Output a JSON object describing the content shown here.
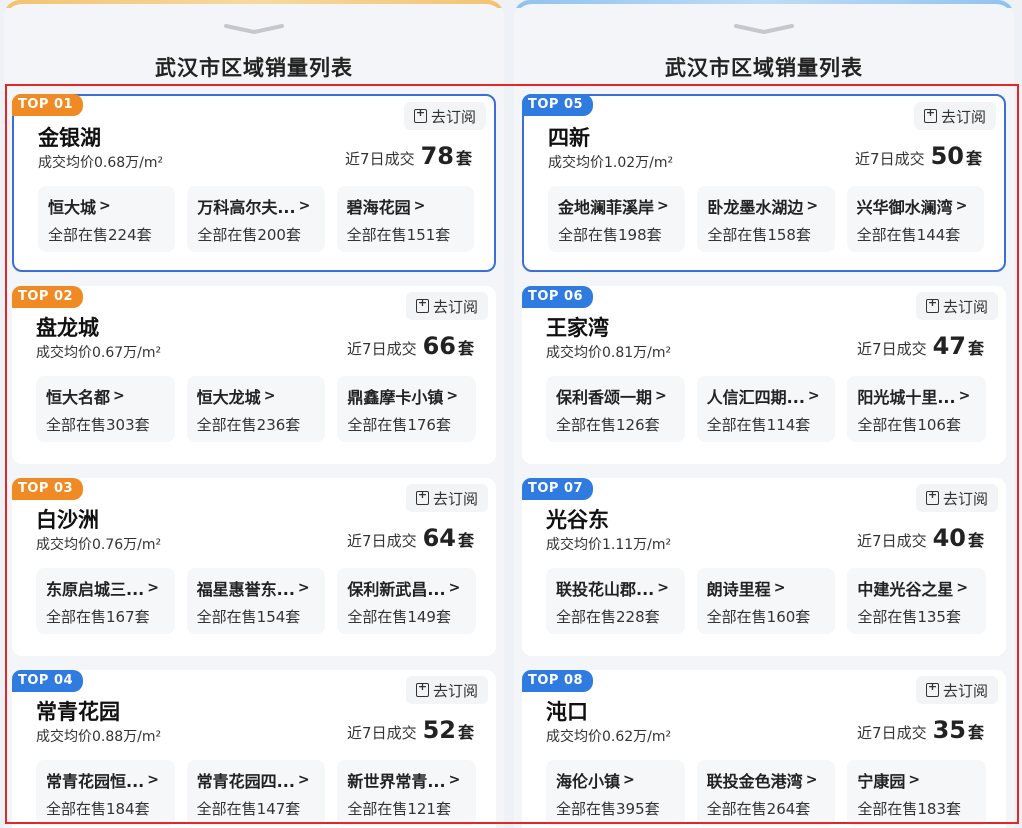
{
  "panels": [
    {
      "title": "武汉市区域销量列表",
      "cards": [
        {
          "rank": "TOP 01",
          "badge_color": "#f08a24",
          "name": "金银湖",
          "price": "成交均价0.68万/m²",
          "label": "近7日成交",
          "count": "78",
          "unit": "套",
          "subscribe": "去订阅",
          "estates": [
            {
              "name": "恒大城",
              "sale": "全部在售224套"
            },
            {
              "name": "万科高尔夫...",
              "sale": "全部在售200套"
            },
            {
              "name": "碧海花园",
              "sale": "全部在售151套"
            }
          ]
        },
        {
          "rank": "TOP 02",
          "badge_color": "#f08a24",
          "name": "盘龙城",
          "price": "成交均价0.67万/m²",
          "label": "近7日成交",
          "count": "66",
          "unit": "套",
          "subscribe": "去订阅",
          "estates": [
            {
              "name": "恒大名都",
              "sale": "全部在售303套"
            },
            {
              "name": "恒大龙城",
              "sale": "全部在售236套"
            },
            {
              "name": "鼎鑫摩卡小镇",
              "sale": "全部在售176套"
            }
          ]
        },
        {
          "rank": "TOP 03",
          "badge_color": "#f08a24",
          "name": "白沙洲",
          "price": "成交均价0.76万/m²",
          "label": "近7日成交",
          "count": "64",
          "unit": "套",
          "subscribe": "去订阅",
          "estates": [
            {
              "name": "东原启城三...",
              "sale": "全部在售167套"
            },
            {
              "name": "福星惠誉东...",
              "sale": "全部在售154套"
            },
            {
              "name": "保利新武昌...",
              "sale": "全部在售149套"
            }
          ]
        },
        {
          "rank": "TOP 04",
          "badge_color": "#2f7be0",
          "name": "常青花园",
          "price": "成交均价0.88万/m²",
          "label": "近7日成交",
          "count": "52",
          "unit": "套",
          "subscribe": "去订阅",
          "estates": [
            {
              "name": "常青花园恒...",
              "sale": "全部在售184套"
            },
            {
              "name": "常青花园四...",
              "sale": "全部在售147套"
            },
            {
              "name": "新世界常青...",
              "sale": "全部在售121套"
            }
          ]
        }
      ]
    },
    {
      "title": "武汉市区域销量列表",
      "cards": [
        {
          "rank": "TOP 05",
          "badge_color": "#2f7be0",
          "name": "四新",
          "price": "成交均价1.02万/m²",
          "label": "近7日成交",
          "count": "50",
          "unit": "套",
          "subscribe": "去订阅",
          "estates": [
            {
              "name": "金地澜菲溪岸",
              "sale": "全部在售198套"
            },
            {
              "name": "卧龙墨水湖边",
              "sale": "全部在售158套"
            },
            {
              "name": "兴华御水澜湾",
              "sale": "全部在售144套"
            }
          ]
        },
        {
          "rank": "TOP 06",
          "badge_color": "#2f7be0",
          "name": "王家湾",
          "price": "成交均价0.81万/m²",
          "label": "近7日成交",
          "count": "47",
          "unit": "套",
          "subscribe": "去订阅",
          "estates": [
            {
              "name": "保利香颂一期",
              "sale": "全部在售126套"
            },
            {
              "name": "人信汇四期...",
              "sale": "全部在售114套"
            },
            {
              "name": "阳光城十里...",
              "sale": "全部在售106套"
            }
          ]
        },
        {
          "rank": "TOP 07",
          "badge_color": "#2f7be0",
          "name": "光谷东",
          "price": "成交均价1.11万/m²",
          "label": "近7日成交",
          "count": "40",
          "unit": "套",
          "subscribe": "去订阅",
          "estates": [
            {
              "name": "联投花山郡...",
              "sale": "全部在售228套"
            },
            {
              "name": "朗诗里程",
              "sale": "全部在售160套"
            },
            {
              "name": "中建光谷之星",
              "sale": "全部在售135套"
            }
          ]
        },
        {
          "rank": "TOP 08",
          "badge_color": "#2f7be0",
          "name": "沌口",
          "price": "成交均价0.62万/m²",
          "label": "近7日成交",
          "count": "35",
          "unit": "套",
          "subscribe": "去订阅",
          "estates": [
            {
              "name": "海伦小镇",
              "sale": "全部在售395套"
            },
            {
              "name": "联投金色港湾",
              "sale": "全部在售264套"
            },
            {
              "name": "宁康园",
              "sale": "全部在售183套"
            }
          ]
        }
      ]
    }
  ]
}
